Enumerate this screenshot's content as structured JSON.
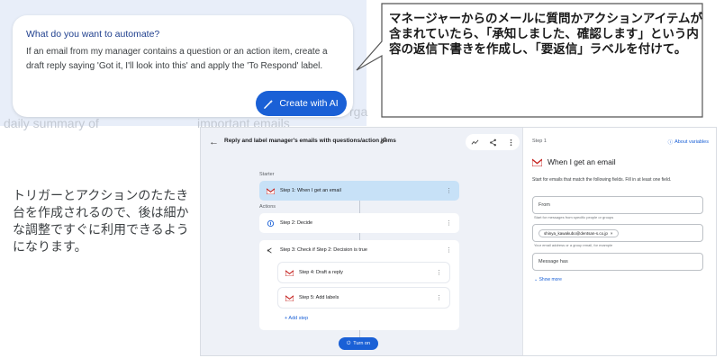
{
  "prompt": {
    "question": "What do you want to automate?",
    "body": "If an email from my manager contains a question or an action item, create a draft reply saying 'Got it, I'll look into this' and apply the 'To Respond' label.",
    "create_button": "Create with AI",
    "ghost_left": "daily summary of",
    "ghost_middle": "important emails",
    "ghost_right": "rga"
  },
  "callout": {
    "text": "マネージャーからのメールに質問かアクションアイテムが含まれていたら、「承知しました、確認します」という内容の返信下書きを作成し、「要返信」ラベルを付けて。"
  },
  "caption": {
    "text": "トリガーとアクションのたたき台を作成されるので、後は細かな調整ですぐに利用できるようになります。"
  },
  "flow": {
    "title": "Reply and label manager's emails with questions/action items",
    "starter_label": "Starter",
    "actions_label": "Actions",
    "step1": "Step 1: When I get an email",
    "step2": "Step 2: Decide",
    "step3": "Step 3: Check if Step 2: Decision is true",
    "step4": "Step 4: Draft a reply",
    "step5": "Step 5: Add labels",
    "add_step": "+ Add step",
    "turn_on": "Turn on"
  },
  "panel": {
    "step_label": "Step 1",
    "about_vars": "About variables",
    "title": "When I get an email",
    "description": "Start for emails that match the following fields. Fill in at least one field.",
    "from_label": "From",
    "from_hint": "Start for messages from specific people or groups",
    "to_label": "To",
    "to_chip": "shinya_kawakubo@dentsan-s.co.jp",
    "to_hint": "Your email address or a group email, for example",
    "message_has": "Message has",
    "show_more": "Show more"
  },
  "colors": {
    "accent_blue": "#1a60d6",
    "prompt_bg": "#e8eef9",
    "active_step": "#c7e1f7"
  },
  "icons": [
    "wand-icon",
    "back-arrow-icon",
    "pencil-icon",
    "activity-icon",
    "share-icon",
    "more-vert-icon",
    "gmail-icon",
    "decide-icon",
    "branch-icon",
    "power-icon",
    "info-icon",
    "chevron-down-icon"
  ]
}
